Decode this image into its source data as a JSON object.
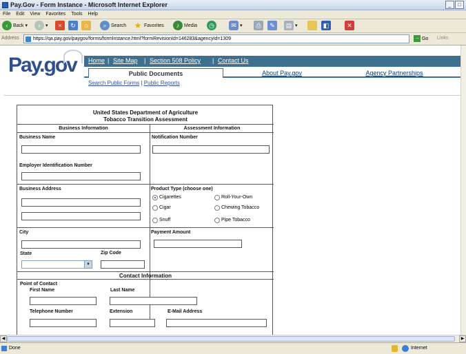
{
  "window": {
    "title": "Pay.Gov - Form Instance - Microsoft Internet Explorer",
    "min": "_",
    "max": "□"
  },
  "menu": [
    "File",
    "Edit",
    "View",
    "Favorites",
    "Tools",
    "Help"
  ],
  "toolbar": {
    "back": "Back",
    "forward": "›",
    "search": "Search",
    "favorites": "Favorites",
    "media": "Media"
  },
  "address": {
    "label": "Address",
    "url": "https://qa.pay.gov/paygov/forms/formInstance.html?formRevisionId=146283&agencyId=1309",
    "go": "Go",
    "links": "Links"
  },
  "site": {
    "logo": "Pay.gov",
    "nav": [
      "Home",
      "Site Map",
      "Section 508 Policy",
      "Contact Us"
    ],
    "tabs": [
      "Public Documents",
      "About Pay.gov",
      "Agency Partnerships"
    ],
    "sublinks": [
      "Search Public Forms",
      "Public Reports"
    ]
  },
  "form": {
    "title1": "United States Department of Agriculture",
    "title2": "Tobacco Transition Assessment",
    "business_header": "Business Information",
    "assessment_header": "Assessment Information",
    "business_name": "Business Name",
    "ein": "Employer Identification Number",
    "notification_number": "Notification Number",
    "business_address": "Business Address",
    "product_type": "Product Type (choose one)",
    "products": [
      {
        "label": "Cigarettes",
        "selected": true
      },
      {
        "label": "Roll-Your-Own",
        "selected": false
      },
      {
        "label": "Cigar",
        "selected": false
      },
      {
        "label": "Chewing Tobacco",
        "selected": false
      },
      {
        "label": "Snuff",
        "selected": false
      },
      {
        "label": "Pipe Tobacco",
        "selected": false
      }
    ],
    "city": "City",
    "state": "State",
    "zip": "Zip Code",
    "payment_amount": "Payment Amount",
    "contact_header": "Contact Information",
    "point_of_contact": "Point of Contact",
    "first_name": "First Name",
    "last_name": "Last Name",
    "telephone": "Telephone Number",
    "extension": "Extension",
    "email": "E-Mail Address"
  },
  "status": {
    "left": "Done",
    "zone": "Internet"
  }
}
